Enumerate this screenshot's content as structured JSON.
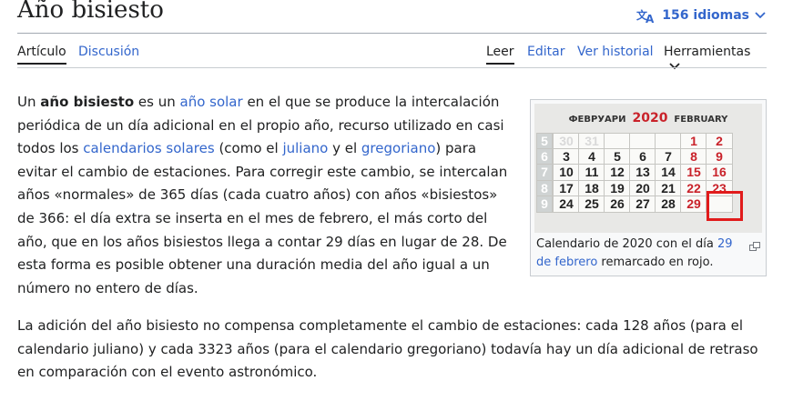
{
  "page": {
    "title": "Año bisiesto",
    "languages_label": "156 idiomas"
  },
  "tabs": {
    "left": [
      "Artículo",
      "Discusión"
    ],
    "right": [
      "Leer",
      "Editar",
      "Ver historial",
      "Herramientas"
    ]
  },
  "paragraph1": [
    {
      "t": "Un ",
      "type": "text"
    },
    {
      "t": "año bisiesto",
      "type": "bold"
    },
    {
      "t": " es un ",
      "type": "text"
    },
    {
      "t": "año solar",
      "type": "link"
    },
    {
      "t": " en el que se produce la intercalación periódica de un día adicional en el propio año, recurso utilizado en casi todos los ",
      "type": "text"
    },
    {
      "t": "calendarios solares",
      "type": "link"
    },
    {
      "t": " (como el ",
      "type": "text"
    },
    {
      "t": "juliano",
      "type": "link"
    },
    {
      "t": " y el ",
      "type": "text"
    },
    {
      "t": "gregoriano",
      "type": "link"
    },
    {
      "t": ") para evitar el cambio de estaciones. Para corregir este cambio, se intercalan años «normales» de 365 días (cada cuatro años) con años «bisiestos» de 366: el día extra se inserta en el mes de febrero, el más corto del año, que en los años bisiestos llega a contar 29 días en lugar de 28. De esta forma es posible obtener una duración media del año igual a un número no entero de días.",
      "type": "text"
    }
  ],
  "paragraph2": "La adición del año bisiesto no compensa completamente el cambio de estaciones: cada 128 años (para el calendario juliano) y cada 3323 años (para el calendario gregoriano) todavía hay un día adicional de retraso en comparación con el evento astronómico.",
  "figure": {
    "calendar_month_cyrillic": "ФЕВРУАРИ",
    "calendar_year": "2020",
    "calendar_month_english": "FEBRUARY",
    "caption_pre": "Calendario de 2020 con el día ",
    "caption_link": "29 de febrero",
    "caption_post": " remarcado en rojo.",
    "week_numbers": [
      "5",
      "6",
      "7",
      "8",
      "9"
    ],
    "rows": [
      [
        "30",
        "31",
        "",
        "",
        "",
        "1",
        "2"
      ],
      [
        "3",
        "4",
        "5",
        "6",
        "7",
        "8",
        "9"
      ],
      [
        "10",
        "11",
        "12",
        "13",
        "14",
        "15",
        "16"
      ],
      [
        "17",
        "18",
        "19",
        "20",
        "21",
        "22",
        "23"
      ],
      [
        "24",
        "25",
        "26",
        "27",
        "28",
        "29",
        ""
      ]
    ],
    "highlight_color": "#e11b1b"
  },
  "colors": {
    "link": "#3366cc",
    "text": "#202122"
  }
}
